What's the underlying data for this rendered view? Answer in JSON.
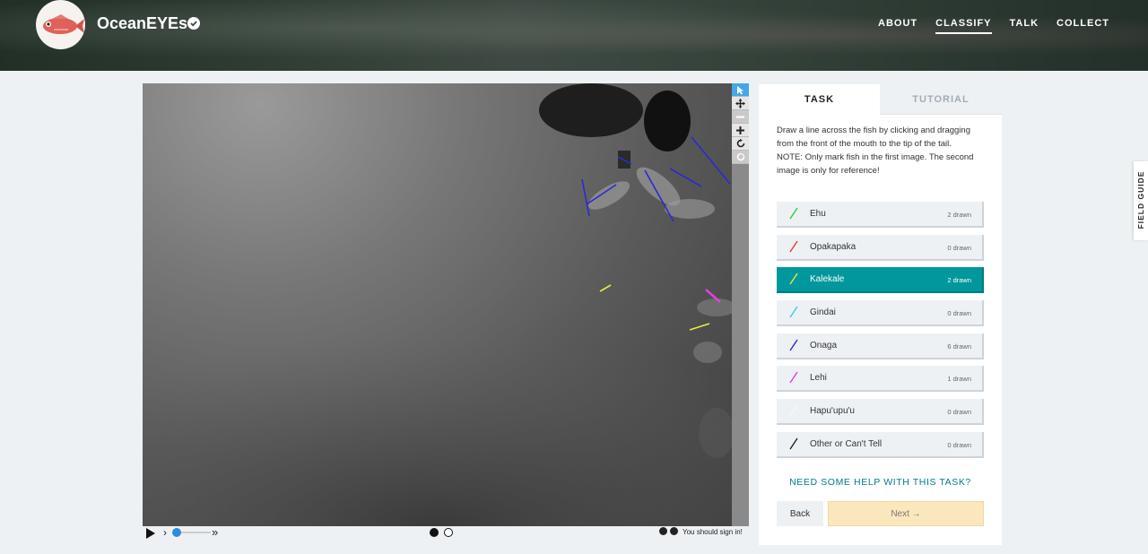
{
  "header": {
    "project_title": "OceanEYEs",
    "nav": [
      "ABOUT",
      "CLASSIFY",
      "TALK",
      "COLLECT"
    ],
    "active_nav": "CLASSIFY"
  },
  "viewer": {
    "tools": [
      "annotate-pointer-icon",
      "pan-icon",
      "zoom-out-icon",
      "zoom-in-icon",
      "rotate-icon",
      "reset-icon"
    ],
    "signin_notice": "You should sign in!"
  },
  "task_panel": {
    "tabs": {
      "task": "TASK",
      "tutorial": "TUTORIAL"
    },
    "instructions_1": "Draw a line across the fish by clicking and dragging from the front of the mouth to the tip of the tail.",
    "instructions_2": "NOTE: Only mark fish in the first image. The second image is only for reference!",
    "options": [
      {
        "label": "Ehu",
        "count": "2 drawn",
        "color": "#2ecc40"
      },
      {
        "label": "Opakapaka",
        "count": "0 drawn",
        "color": "#e0403a"
      },
      {
        "label": "Kalekale",
        "count": "2 drawn",
        "color": "#e8e84a"
      },
      {
        "label": "Gindai",
        "count": "0 drawn",
        "color": "#33ccee"
      },
      {
        "label": "Onaga",
        "count": "6 drawn",
        "color": "#2a2ad0"
      },
      {
        "label": "Lehi",
        "count": "1 drawn",
        "color": "#e040e0"
      },
      {
        "label": "Hapu'upu'u",
        "count": "0 drawn",
        "color": "#f5f5f5"
      },
      {
        "label": "Other or Can't Tell",
        "count": "0 drawn",
        "color": "#222222"
      }
    ],
    "selected_option": "Kalekale",
    "help_link": "NEED SOME HELP WITH THIS TASK?",
    "back_label": "Back",
    "next_label": "Next →"
  },
  "field_guide": "FIELD GUIDE"
}
